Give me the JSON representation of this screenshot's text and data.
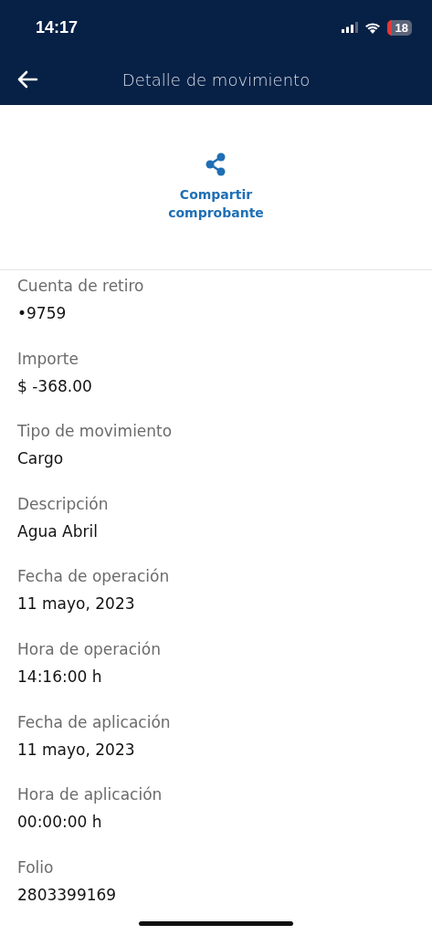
{
  "status_bar": {
    "time": "14:17",
    "battery": "18"
  },
  "header": {
    "title": "Detalle de movimiento"
  },
  "share": {
    "label": "Compartir\ncomprobante"
  },
  "fields": [
    {
      "label": "Cuenta de retiro",
      "value": "•9759"
    },
    {
      "label": "Importe",
      "value": "$ -368.00"
    },
    {
      "label": "Tipo de movimiento",
      "value": "Cargo"
    },
    {
      "label": "Descripción",
      "value": "Agua Abril"
    },
    {
      "label": "Fecha de operación",
      "value": "11 mayo, 2023"
    },
    {
      "label": "Hora de operación",
      "value": "14:16:00 h"
    },
    {
      "label": "Fecha de aplicación",
      "value": "11 mayo, 2023"
    },
    {
      "label": "Hora de aplicación",
      "value": "00:00:00 h"
    },
    {
      "label": "Folio",
      "value": "2803399169"
    }
  ]
}
